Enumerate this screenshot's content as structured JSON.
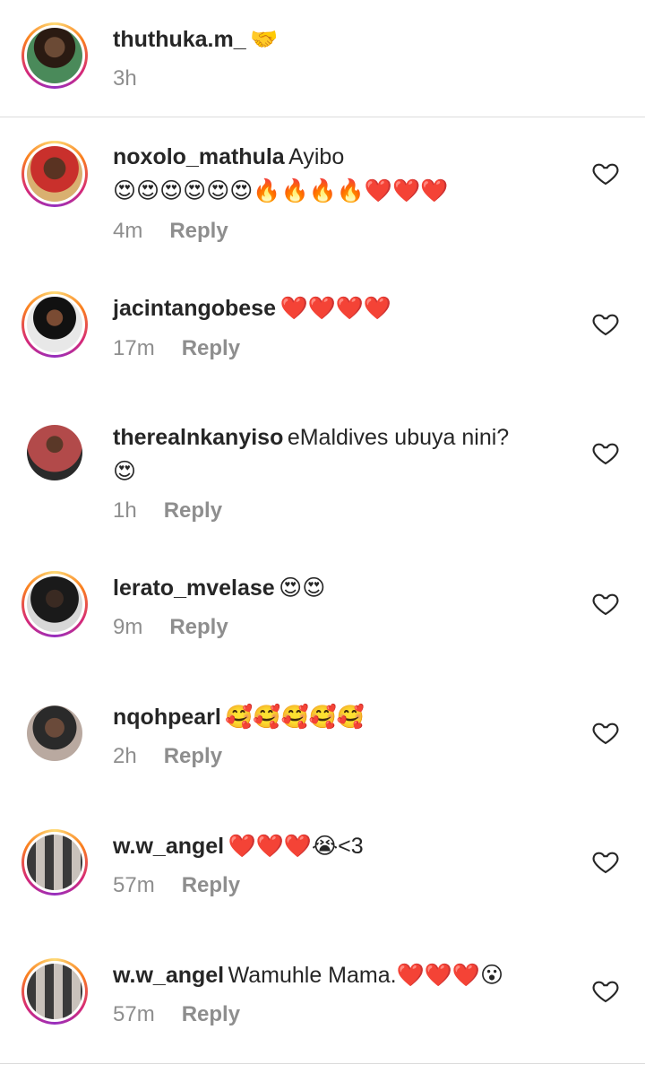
{
  "caption": {
    "username": "thuthuka.m_",
    "emoji": "🤝",
    "time": "3h"
  },
  "comments": [
    {
      "username": "noxolo_mathula",
      "text": "Ayibo",
      "text2": "😍😍😍😍😍😍🔥🔥🔥🔥❤️❤️❤️",
      "time": "4m",
      "reply": "Reply",
      "ring": true
    },
    {
      "username": "jacintangobese",
      "text": "❤️❤️❤️❤️",
      "time": "17m",
      "reply": "Reply",
      "ring": true
    },
    {
      "username": "therealnkanyiso",
      "text": "eMaldives ubuya nini?",
      "text2": "😍",
      "time": "1h",
      "reply": "Reply",
      "ring": false
    },
    {
      "username": "lerato_mvelase",
      "text": "😍😍",
      "time": "9m",
      "reply": "Reply",
      "ring": true
    },
    {
      "username": "nqohpearl",
      "text": "🥰🥰🥰🥰🥰",
      "time": "2h",
      "reply": "Reply",
      "ring": false
    },
    {
      "username": "w.w_angel",
      "text": "❤️❤️❤️😭<3",
      "time": "57m",
      "reply": "Reply",
      "ring": true
    },
    {
      "username": "w.w_angel",
      "text": "Wamuhle Mama.❤️❤️❤️😮",
      "time": "57m",
      "reply": "Reply",
      "ring": true
    }
  ],
  "colors": {
    "username": "#262626",
    "meta": "#8e8e8e",
    "divider": "#dbdbdb"
  },
  "icons": {
    "like": "heart-outline-icon"
  }
}
